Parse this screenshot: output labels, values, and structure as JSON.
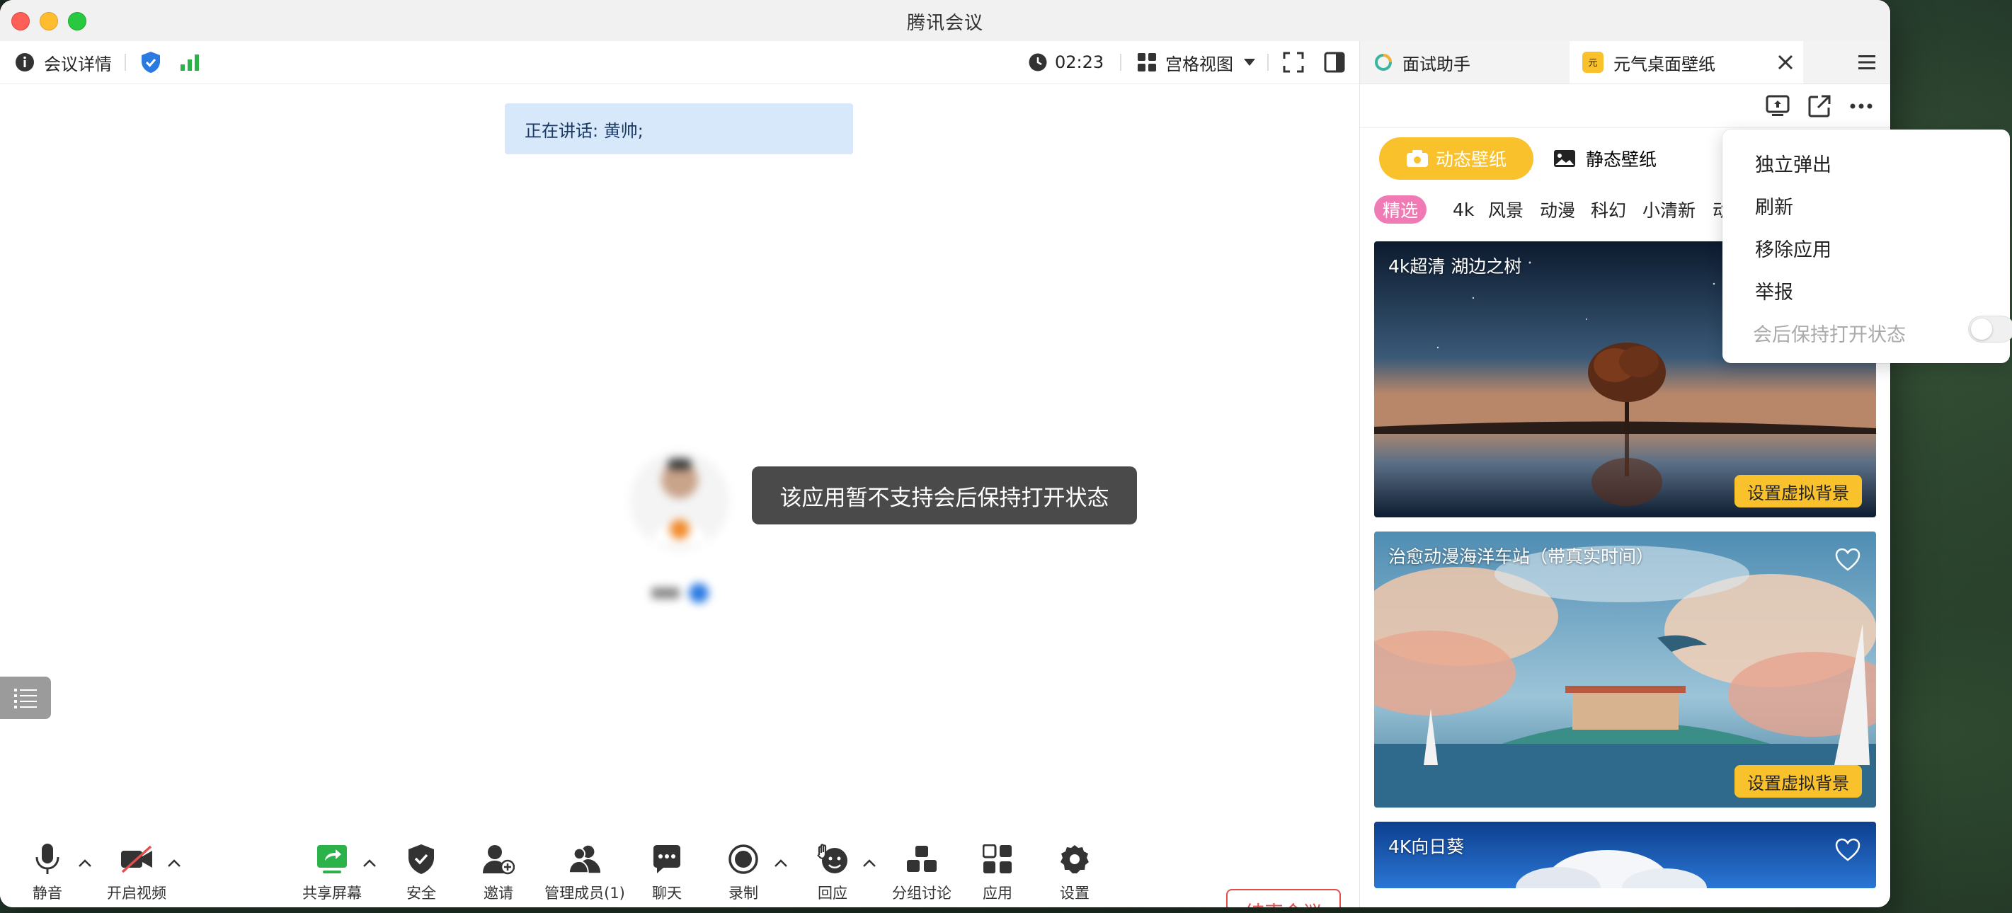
{
  "window": {
    "title": "腾讯会议"
  },
  "topbar": {
    "meeting_details": "会议详情",
    "timer": "02:23",
    "view_mode": "宫格视图"
  },
  "main": {
    "speaker_banner": "正在讲话: 黄帅;",
    "toast": "该应用暂不支持会后保持打开状态"
  },
  "toolbar": {
    "mute": "静音",
    "video": "开启视频",
    "share": "共享屏幕",
    "security": "安全",
    "invite": "邀请",
    "members": "管理成员(1)",
    "chat": "聊天",
    "record": "录制",
    "react": "回应",
    "breakout": "分组讨论",
    "apps": "应用",
    "settings": "设置",
    "end_meeting": "结束会议"
  },
  "panel": {
    "tabs": [
      {
        "label": "面试助手"
      },
      {
        "label": "元气桌面壁纸"
      }
    ],
    "categories": [
      {
        "label": "动态壁纸"
      },
      {
        "label": "静态壁纸"
      }
    ],
    "filters": [
      "精选",
      "4k",
      "风景",
      "动漫",
      "科幻",
      "小清新",
      "动"
    ],
    "cards": [
      {
        "title": "4k超清 湖边之树",
        "button": "设置虚拟背景"
      },
      {
        "title": "治愈动漫海洋车站（带真实时间）",
        "button": "设置虚拟背景"
      },
      {
        "title": "4K向日葵"
      }
    ]
  },
  "menu": {
    "items": [
      "独立弹出",
      "刷新",
      "移除应用",
      "举报"
    ],
    "toggle_label": "会后保持打开状态",
    "toggle_on": false
  },
  "colors": {
    "accent_yellow": "#f9c22d",
    "pink": "#f07ab3",
    "end_red": "#e34d4d",
    "signal_green": "#2bb34a",
    "shield_blue": "#2a7ae2"
  }
}
